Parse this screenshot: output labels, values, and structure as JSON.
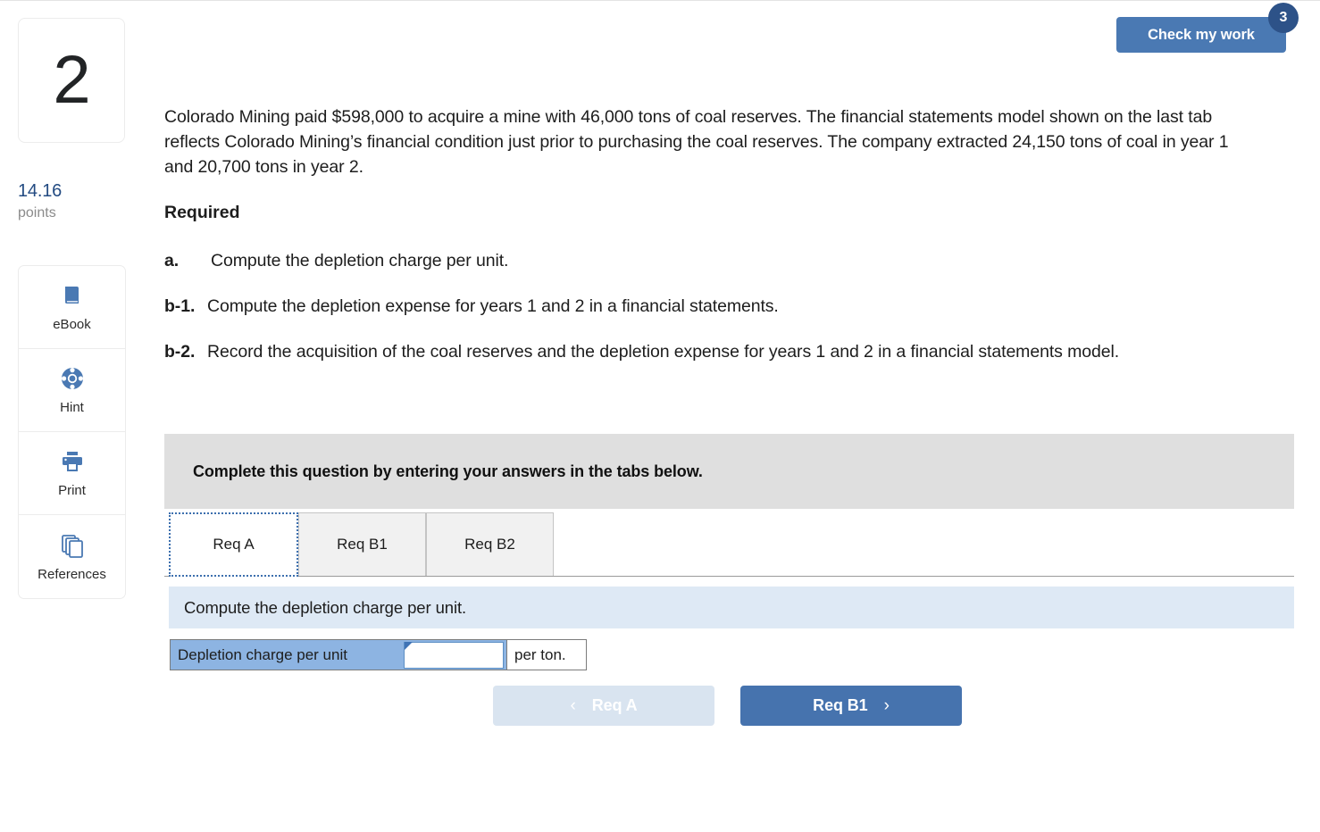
{
  "question": {
    "number": "2",
    "points_value": "14.16",
    "points_label": "points"
  },
  "tools": [
    {
      "icon": "book-icon",
      "label": "eBook"
    },
    {
      "icon": "lifebuoy-icon",
      "label": "Hint"
    },
    {
      "icon": "printer-icon",
      "label": "Print"
    },
    {
      "icon": "pages-stack-icon",
      "label": "References"
    }
  ],
  "check_my_work": {
    "label": "Check my work",
    "badge_count": "3",
    "button_color": "#4a79b3",
    "badge_color": "#2d5288"
  },
  "body": {
    "intro": "Colorado Mining paid $598,000 to acquire a mine with 46,000 tons of coal reserves. The financial statements model shown on the last tab reflects Colorado Mining’s financial condition just prior to purchasing the coal reserves. The company extracted 24,150 tons of coal in year 1 and 20,700 tons in year 2.",
    "required_heading": "Required",
    "requirements": [
      {
        "mark": "a.",
        "text": "Compute the depletion charge per unit."
      },
      {
        "mark": "b-1.",
        "text": "Compute the depletion expense for years 1 and 2 in a financial statements."
      },
      {
        "mark": "b-2.",
        "text": "Record the acquisition of the coal reserves and the depletion expense for years 1 and 2 in a financial statements model."
      }
    ]
  },
  "banner": {
    "text": "Complete this question by entering your answers in the tabs below."
  },
  "tabs": [
    {
      "label": "Req A",
      "active": true
    },
    {
      "label": "Req B1",
      "active": false
    },
    {
      "label": "Req B2",
      "active": false
    }
  ],
  "tab_content": {
    "instruction": "Compute the depletion charge per unit.",
    "answer_row": {
      "label": "Depletion charge per unit",
      "input_value": "",
      "input_placeholder": "",
      "unit": "per ton.",
      "label_color": "#8db4e2"
    }
  },
  "navigation": {
    "prev": {
      "label": "Req A",
      "chevron": "‹",
      "disabled": true,
      "color": "#d9e4f0"
    },
    "next": {
      "label": "Req B1",
      "chevron": "›",
      "disabled": false,
      "color": "#4673ae"
    }
  }
}
